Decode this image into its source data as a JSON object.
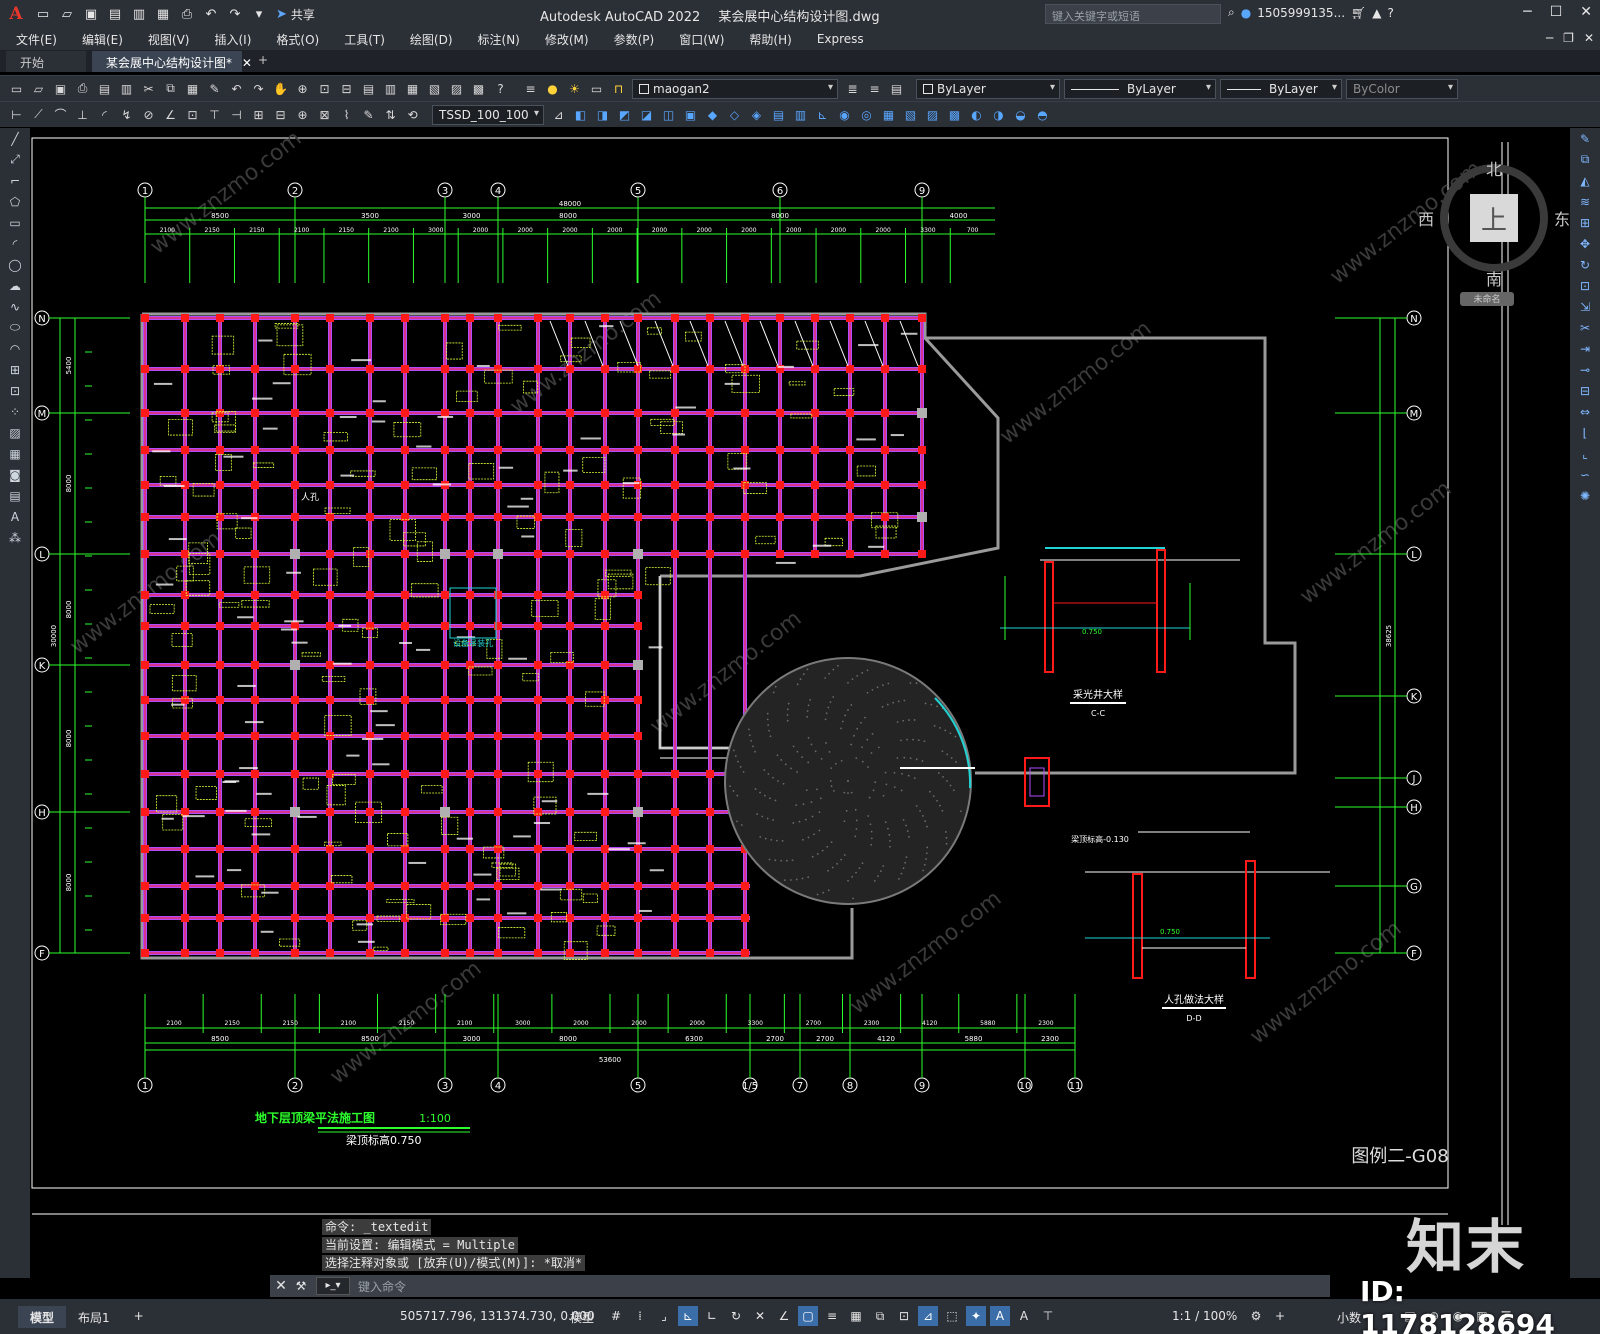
{
  "app": {
    "logo": "A",
    "title_product": "Autodesk AutoCAD 2022",
    "title_file": "某会展中心结构设计图.dwg",
    "share_label": "共享",
    "search_placeholder": "键入关键字或短语",
    "user": "1505999135...",
    "quick_access_icons": [
      "new-icon",
      "open-icon",
      "save-icon",
      "saveas-icon",
      "open-web-icon",
      "save-web-icon",
      "plot-icon",
      "undo-icon",
      "redo-icon",
      "more-icon"
    ]
  },
  "menus": [
    "文件(E)",
    "编辑(E)",
    "视图(V)",
    "插入(I)",
    "格式(O)",
    "工具(T)",
    "绘图(D)",
    "标注(N)",
    "修改(M)",
    "参数(P)",
    "窗口(W)",
    "帮助(H)",
    "Express"
  ],
  "tabs": {
    "start": "开始",
    "active": "某会展中心结构设计图*",
    "add": "+"
  },
  "toolbar": {
    "layer_name": "maogan2",
    "color": "ByLayer",
    "linetype": "ByLayer",
    "lineweight": "ByLayer",
    "plotstyle": "ByColor",
    "dimstyle": "TSSD_100_100"
  },
  "viewcube": {
    "north": "北",
    "south": "南",
    "west": "西",
    "east": "东",
    "face": "上",
    "wcs": "未命名"
  },
  "drawing": {
    "grid_top": [
      "1",
      "2",
      "3",
      "4",
      "5",
      "6",
      "9"
    ],
    "grid_bottom": [
      "1",
      "2",
      "3",
      "4",
      "5",
      "1/5",
      "7",
      "8",
      "9",
      "10",
      "11"
    ],
    "grid_left": [
      "N",
      "M",
      "L",
      "K",
      "H",
      "F"
    ],
    "grid_right": [
      "N",
      "M",
      "L",
      "K",
      "J",
      "H",
      "G",
      "F"
    ],
    "dims_top_total": "48000",
    "dims_top_row1": [
      "8500",
      "3500",
      "3000",
      "8000",
      "8000",
      "4000"
    ],
    "dims_top_row2": [
      "2100",
      "2150",
      "2150",
      "2100",
      "2150",
      "2100",
      "3000",
      "2000",
      "2000",
      "2000",
      "2000",
      "2000",
      "2000",
      "2000",
      "2000",
      "2000",
      "2000",
      "3300",
      "700"
    ],
    "dims_bottom_total": "53600",
    "dims_bottom_row1": [
      "8500",
      "8500",
      "3000",
      "8000",
      "6300",
      "2700",
      "2700",
      "4120",
      "5880",
      "2300"
    ],
    "dims_bottom_row2": [
      "2100",
      "2150",
      "2150",
      "2100",
      "2150",
      "2100",
      "3000",
      "2000",
      "2000",
      "2000",
      "3300",
      "2700",
      "2300",
      "4120",
      "5880",
      "2300"
    ],
    "dims_left": [
      "5400",
      "8000",
      "8000",
      "8000",
      "8000"
    ],
    "dims_left_total": "30000",
    "dims_right_total": "38625",
    "title_main": "地下层顶梁平法施工图",
    "title_scale": "1:100",
    "title_note": "梁顶标高0.750",
    "detail1_title": "采光井大样",
    "detail1_sub": "C-C",
    "detail2_title": "人孔做法大样",
    "detail2_sub": "D-D",
    "label_renkong": "人孔",
    "label_device": "设备吊装孔",
    "label_elev": "0.750",
    "label_elev2": "梁顶标高-0.130",
    "drawing_no": "图例二-G08"
  },
  "command": {
    "history": [
      "命令: _textedit",
      "当前设置: 编辑模式 = Multiple",
      "选择注释对象或 [放弃(U)/模式(M)]: *取消*"
    ],
    "placeholder": "键入命令"
  },
  "status": {
    "layout_tabs": [
      "模型",
      "布局1"
    ],
    "coords": "505717.796, 131374.730, 0.000",
    "model": "模型",
    "scale": "1:1 / 100%",
    "units": "小数"
  },
  "watermark": {
    "logo": "知末",
    "id": "ID: 1178128694",
    "site": "www.znzmo.com"
  }
}
